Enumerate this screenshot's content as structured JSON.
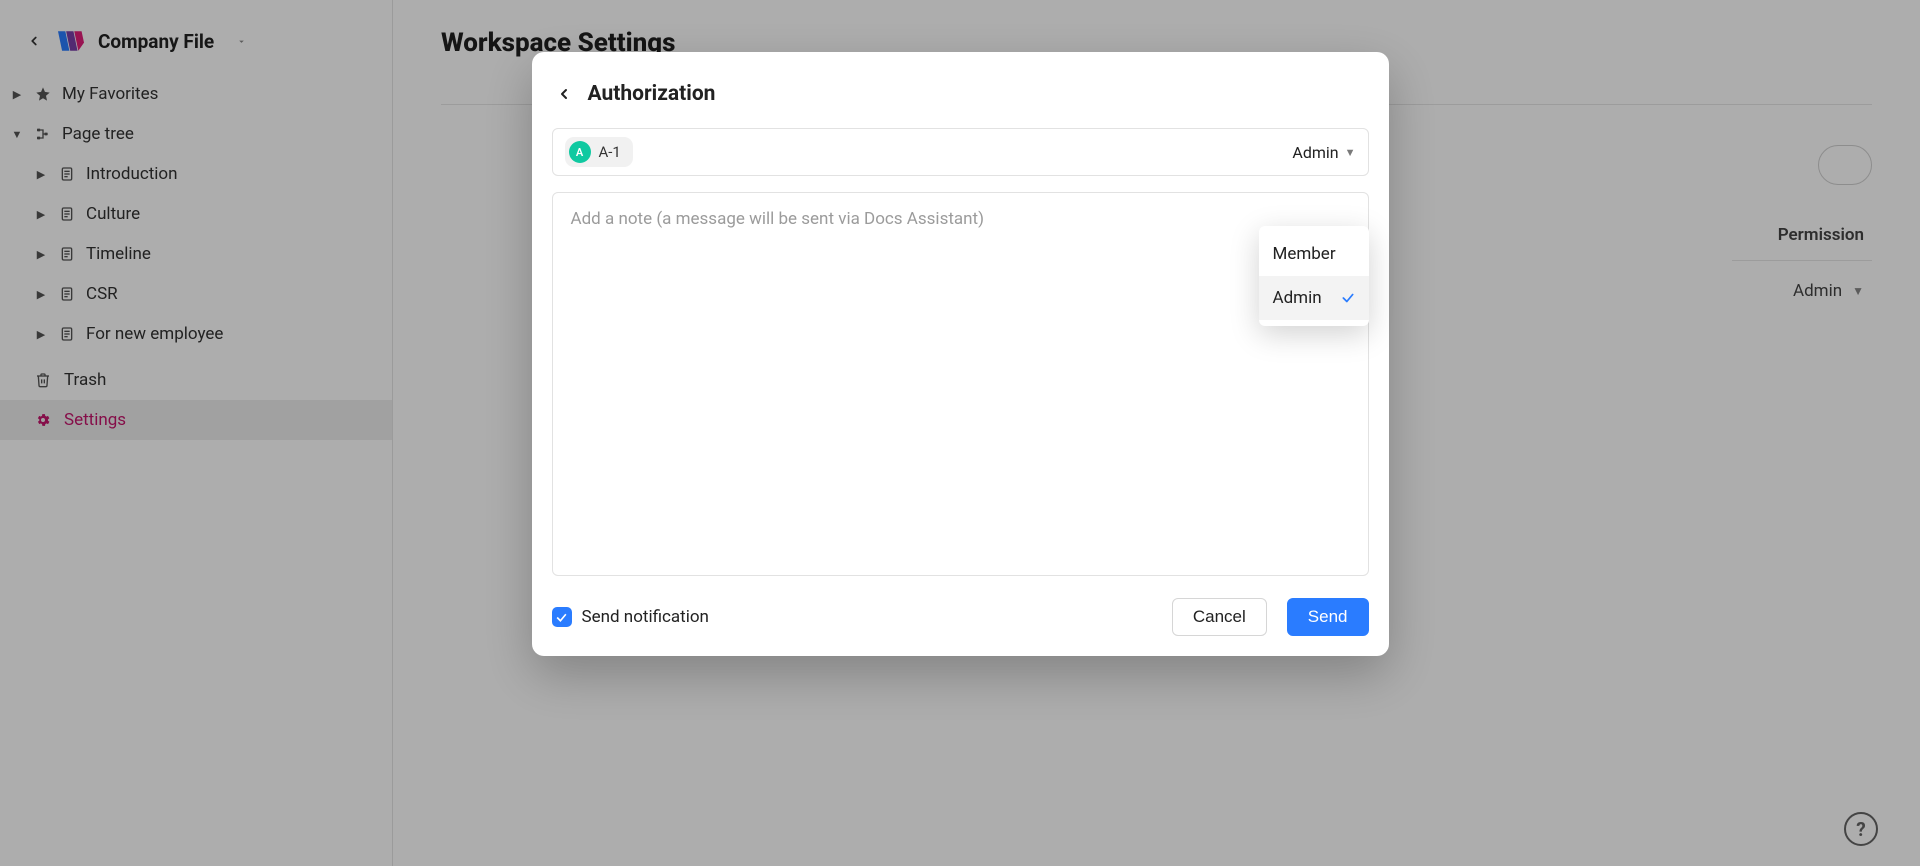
{
  "sidebar": {
    "workspace_name": "Company File",
    "favorites_label": "My Favorites",
    "page_tree_label": "Page tree",
    "pages": [
      {
        "label": "Introduction"
      },
      {
        "label": "Culture"
      },
      {
        "label": "Timeline"
      },
      {
        "label": "CSR"
      },
      {
        "label": "For new employee"
      }
    ],
    "trash_label": "Trash",
    "settings_label": "Settings"
  },
  "main": {
    "title": "Workspace Settings",
    "permission_header": "Permission",
    "row_role": "Admin"
  },
  "modal": {
    "title": "Authorization",
    "recipient": {
      "avatar_initial": "A",
      "name": "A-1"
    },
    "role_selected": "Admin",
    "role_options": [
      "Member",
      "Admin"
    ],
    "note_placeholder": "Add a note (a message will be sent via Docs Assistant)",
    "send_notification_label": "Send notification",
    "send_notification_checked": true,
    "cancel_label": "Cancel",
    "send_label": "Send"
  },
  "help_label": "?"
}
